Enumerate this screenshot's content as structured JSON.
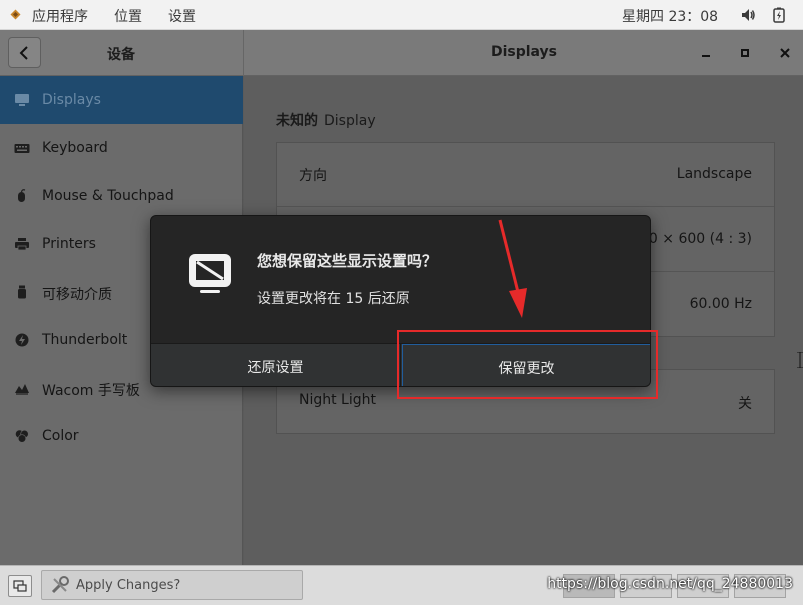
{
  "topbar": {
    "applications": "应用程序",
    "places": "位置",
    "settings": "设置",
    "clock": "星期四 23：08"
  },
  "window": {
    "sidebar_title": "设备",
    "title": "Displays"
  },
  "sidebar": {
    "items": [
      {
        "label": "Displays",
        "icon": "display-icon",
        "selected": true
      },
      {
        "label": "Keyboard",
        "icon": "keyboard-icon"
      },
      {
        "label": "Mouse & Touchpad",
        "icon": "mouse-icon"
      },
      {
        "label": "Printers",
        "icon": "printer-icon"
      },
      {
        "label": "可移动介质",
        "icon": "removable-media-icon"
      },
      {
        "label": "Thunderbolt",
        "icon": "thunderbolt-icon"
      },
      {
        "label": "Wacom 手写板",
        "icon": "tablet-icon"
      },
      {
        "label": "Color",
        "icon": "color-icon"
      }
    ]
  },
  "main": {
    "section_title_prefix": "未知的",
    "section_title_display": "Display",
    "rows": [
      {
        "label": "方向",
        "value": "Landscape"
      },
      {
        "label": "",
        "value": "800 × 600 (4 : 3)"
      },
      {
        "label": "",
        "value": "60.00 Hz"
      }
    ],
    "night_light": {
      "label": "Night Light",
      "value": "关"
    }
  },
  "dialog": {
    "title": "您想保留这些显示设置吗？",
    "message": "设置更改将在 15 后还原",
    "revert_label": "还原设置",
    "keep_label": "保留更改"
  },
  "taskbar": {
    "task_label": "Apply Changes?"
  },
  "watermark": "https://blog.csdn.net/qq_24880013",
  "colors": {
    "selection": "#1f4a6e",
    "dialog_bg": "#252525",
    "focus_border": "#215d9c",
    "annotation": "#e62a2a"
  }
}
